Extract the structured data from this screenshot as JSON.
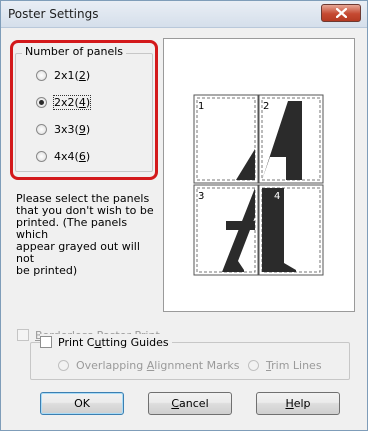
{
  "window": {
    "title": "Poster Settings"
  },
  "panels_group": {
    "legend": "Number of panels",
    "options": [
      {
        "label": "2x1",
        "key": "2",
        "checked": false
      },
      {
        "label": "2x2",
        "key": "4",
        "checked": true
      },
      {
        "label": "3x3",
        "key": "9",
        "checked": false
      },
      {
        "label": "4x4",
        "key": "6",
        "checked": false
      }
    ]
  },
  "description": "Please select the panels\nthat you don't wish to be\nprinted. (The panels which\nappear grayed out will not\nbe printed)",
  "preview": {
    "panels": [
      "1",
      "2",
      "3",
      "4"
    ],
    "glyph": "A"
  },
  "borderless": {
    "first": "B",
    "rest": "orderless Poster Print",
    "checked": false,
    "enabled": false
  },
  "cutting_guides": {
    "pre": "Print C",
    "key": "u",
    "post": "tting Guides",
    "checked": false,
    "overlapping": {
      "pre": "Overlapping ",
      "key": "A",
      "post": "lignment Marks",
      "enabled": false
    },
    "trim": {
      "key": "T",
      "post": "rim Lines",
      "enabled": false
    }
  },
  "buttons": {
    "ok": "OK",
    "cancel": {
      "key": "C",
      "post": "ancel"
    },
    "help": {
      "key": "H",
      "post": "elp"
    }
  },
  "colors": {
    "highlight": "#d3191b",
    "close": "#c54a32"
  },
  "icons": {
    "close": "close-icon"
  }
}
